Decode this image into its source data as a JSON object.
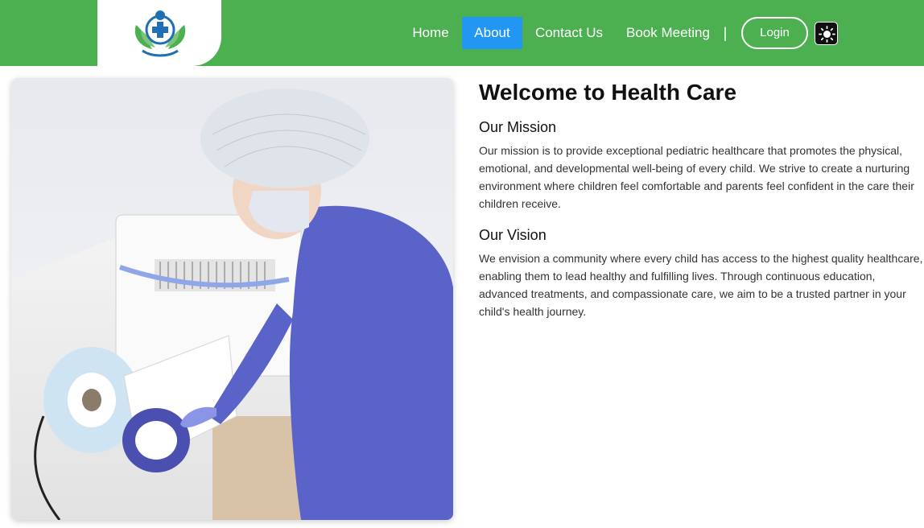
{
  "nav": {
    "items": [
      {
        "label": "Home"
      },
      {
        "label": "About",
        "active": true
      },
      {
        "label": "Contact Us"
      },
      {
        "label": "Book Meeting"
      }
    ],
    "divider": "|",
    "login_label": "Login",
    "theme_icon": "sun-icon",
    "logo_icon": "medical-cross-leaves-logo"
  },
  "colors": {
    "navbar_bg": "#4caf50",
    "active_tab_bg": "#2196f3",
    "logo_blue": "#1e6fb3",
    "logo_green": "#4caf50"
  },
  "main": {
    "title": "Welcome to Health Care",
    "mission": {
      "heading": "Our Mission",
      "text": "Our mission is to provide exceptional pediatric healthcare that promotes the physical, emotional, and developmental well-being of every child. We strive to create a nurturing environment where children feel comfortable and parents feel confident in the care their children receive."
    },
    "vision": {
      "heading": "Our Vision",
      "text": "We envision a community where every child has access to the highest quality healthcare, enabling them to lead healthy and fulfilling lives. Through continuous education, advanced treatments, and compassionate care, we aim to be a trusted partner in your child's health journey."
    }
  }
}
